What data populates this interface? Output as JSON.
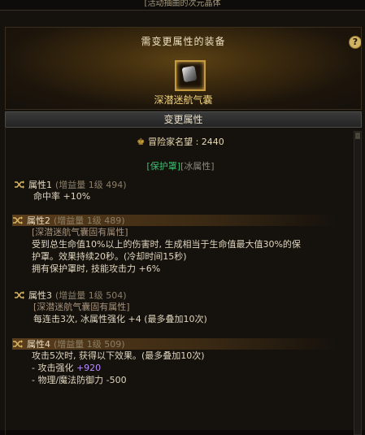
{
  "window": {
    "top_caption": "[活动抽曲的次元晶体"
  },
  "header": {
    "title": "需变更属性的装备",
    "help": "?",
    "item_name": "深潜迷航气囊"
  },
  "section": {
    "title": "变更属性"
  },
  "fame": {
    "label": "冒险家名望 : 2440"
  },
  "tags": {
    "protect": "[保护罩]",
    "element": "[冰属性]"
  },
  "attributes": [
    {
      "name": "属性1",
      "meta": "(增益量 1级 494)",
      "lines": [
        "命中率 +10%"
      ]
    },
    {
      "name": "属性2",
      "meta": "(增益量 1级 489)",
      "sub": "[深潜迷航气囊固有属性]",
      "lines": [
        "受到总生命值10%以上的伤害时, 生成相当于生命值最大值30%的保",
        "护罩。效果持续20秒。(冷却时间15秒)",
        "拥有保护罩时, 技能攻击力 +6%"
      ]
    },
    {
      "name": "属性3",
      "meta": "(增益量 1级 504)",
      "sub": "[深潜迷航气囊固有属性]",
      "lines": [
        "每连击3次, 冰属性强化 +4 (最多叠加10次)"
      ]
    },
    {
      "name": "属性4",
      "meta": "(增益量 1级 509)",
      "lines": [
        "攻击5次时, 获得以下效果。(最多叠加10次)",
        "- 攻击强化",
        "- 物理/魔法防御力 -500"
      ],
      "bonus": "+920"
    }
  ]
}
